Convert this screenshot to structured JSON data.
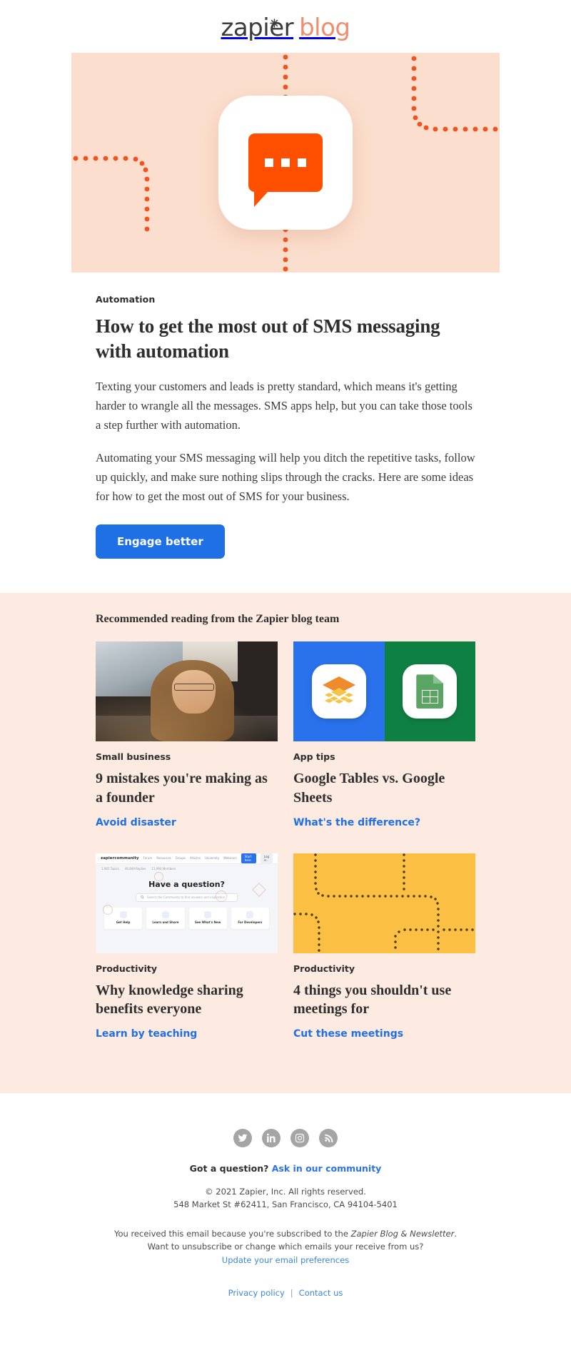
{
  "masthead": {
    "logo_primary": "zapier",
    "logo_secondary": "blog",
    "spark_icon": "asterisk-spark-icon"
  },
  "hero": {
    "background_color": "#fbdecd",
    "accent_color": "#ff4f00",
    "icon": "sms-chat-bubble-icon",
    "alt": "Orange SMS chat bubble app icon on peach background with dotted connection paths"
  },
  "feature": {
    "category": "Automation",
    "headline": "How to get the most out of SMS messaging with automation",
    "paragraph_1": "Texting your customers and leads is pretty standard, which means it's getting harder to wrangle all the messages. SMS apps help, but you can take those tools a step further with automation.",
    "paragraph_2": "Automating your SMS messaging will help you ditch the repetitive tasks, follow up quickly, and make sure nothing slips through the cracks. Here are some ideas for how to get the most out of SMS for your business.",
    "cta_label": "Engage better",
    "cta_color": "#1f6fe5"
  },
  "recommended": {
    "title": "Recommended reading from the Zapier blog team",
    "background_color": "#fdeae1",
    "cards": [
      {
        "thumb": "photo-woman-at-laptop",
        "category": "Small business",
        "title": "9 mistakes you're making as a founder",
        "link_label": "Avoid disaster"
      },
      {
        "thumb": "google-tables-and-google-sheets-icons",
        "category": "App tips",
        "title": "Google Tables vs. Google Sheets",
        "link_label": "What's the difference?"
      },
      {
        "thumb": "zapier-community-screenshot",
        "category": "Productivity",
        "title": "Why knowledge sharing benefits everyone",
        "link_label": "Learn by teaching"
      },
      {
        "thumb": "yellow-dotted-paths",
        "category": "Productivity",
        "title": "4 things you shouldn't use meetings for",
        "link_label": "Cut these meetings"
      }
    ]
  },
  "community_thumb": {
    "brand_prefix": "zapier",
    "brand_suffix": "community",
    "nav": [
      "Forum",
      "Resources",
      "Groups",
      "Articles",
      "University",
      "Webinars"
    ],
    "btn_primary": "Start here",
    "btn_secondary": "Log in",
    "stats": [
      "1,981 Topics",
      "46,849 Replies",
      "11,994 Members"
    ],
    "heading": "Have a question?",
    "search_placeholder": "Search the Community to find answers and inspiration",
    "tiles": [
      "Get Help",
      "Learn and Share",
      "See What's New",
      "For Developers"
    ]
  },
  "footer": {
    "socials": [
      {
        "name": "twitter-icon",
        "label": "Twitter"
      },
      {
        "name": "linkedin-icon",
        "label": "LinkedIn"
      },
      {
        "name": "instagram-icon",
        "label": "Instagram"
      },
      {
        "name": "rss-icon",
        "label": "RSS"
      }
    ],
    "question_text": "Got a question?",
    "question_link": "Ask in our community",
    "copyright": "© 2021 Zapier, Inc. All rights reserved.",
    "address": "548 Market St #62411, San Francisco, CA 94104-5401",
    "sub_line_1a": "You received this email because you're subscribed to the ",
    "sub_line_1b": "Zapier Blog & Newsletter",
    "sub_line_1c": ".",
    "sub_line_2": "Want to unsubscribe or change which emails your receive from us?",
    "preferences_link": "Update your email preferences",
    "privacy_link": "Privacy policy",
    "separator": "|",
    "contact_link": "Contact us"
  }
}
